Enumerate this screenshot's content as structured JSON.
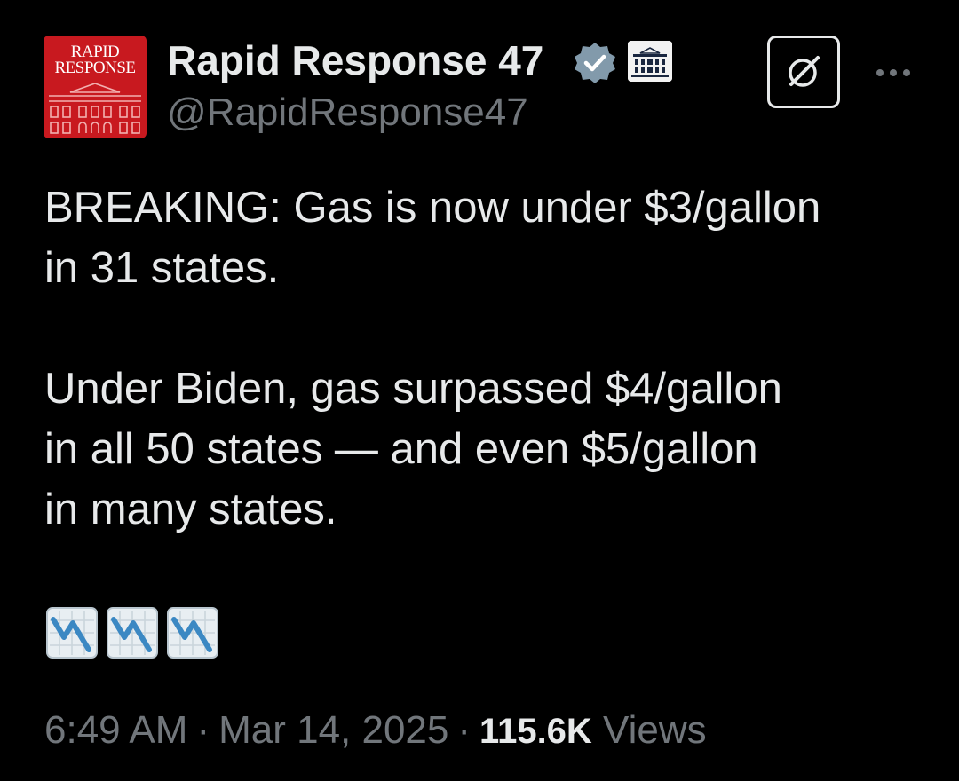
{
  "author": {
    "display_name": "Rapid Response 47",
    "handle": "@RapidResponse47",
    "avatar_text_line1": "RAPID",
    "avatar_text_line2": "RESPONSE",
    "avatar_color": "#c8191f",
    "verified_color": "#829aab"
  },
  "actions": {
    "grok_icon": "grok-icon",
    "more_icon": "more-icon"
  },
  "tweet": {
    "lines": [
      "BREAKING: Gas is now under $3/gallon",
      "in 31 states.",
      "Under Biden, gas surpassed $4/gallon",
      "in all 50 states — and even $5/gallon",
      "in many states."
    ],
    "emojis": [
      "chart-decreasing-emoji",
      "chart-decreasing-emoji",
      "chart-decreasing-emoji"
    ]
  },
  "meta": {
    "time": "6:49 AM",
    "date": "Mar 14, 2025",
    "views_count": "115.6K",
    "views_label": "Views",
    "separator": "·"
  },
  "colors": {
    "background": "#000000",
    "text_primary": "#e7e9ea",
    "text_secondary": "#71767b"
  }
}
